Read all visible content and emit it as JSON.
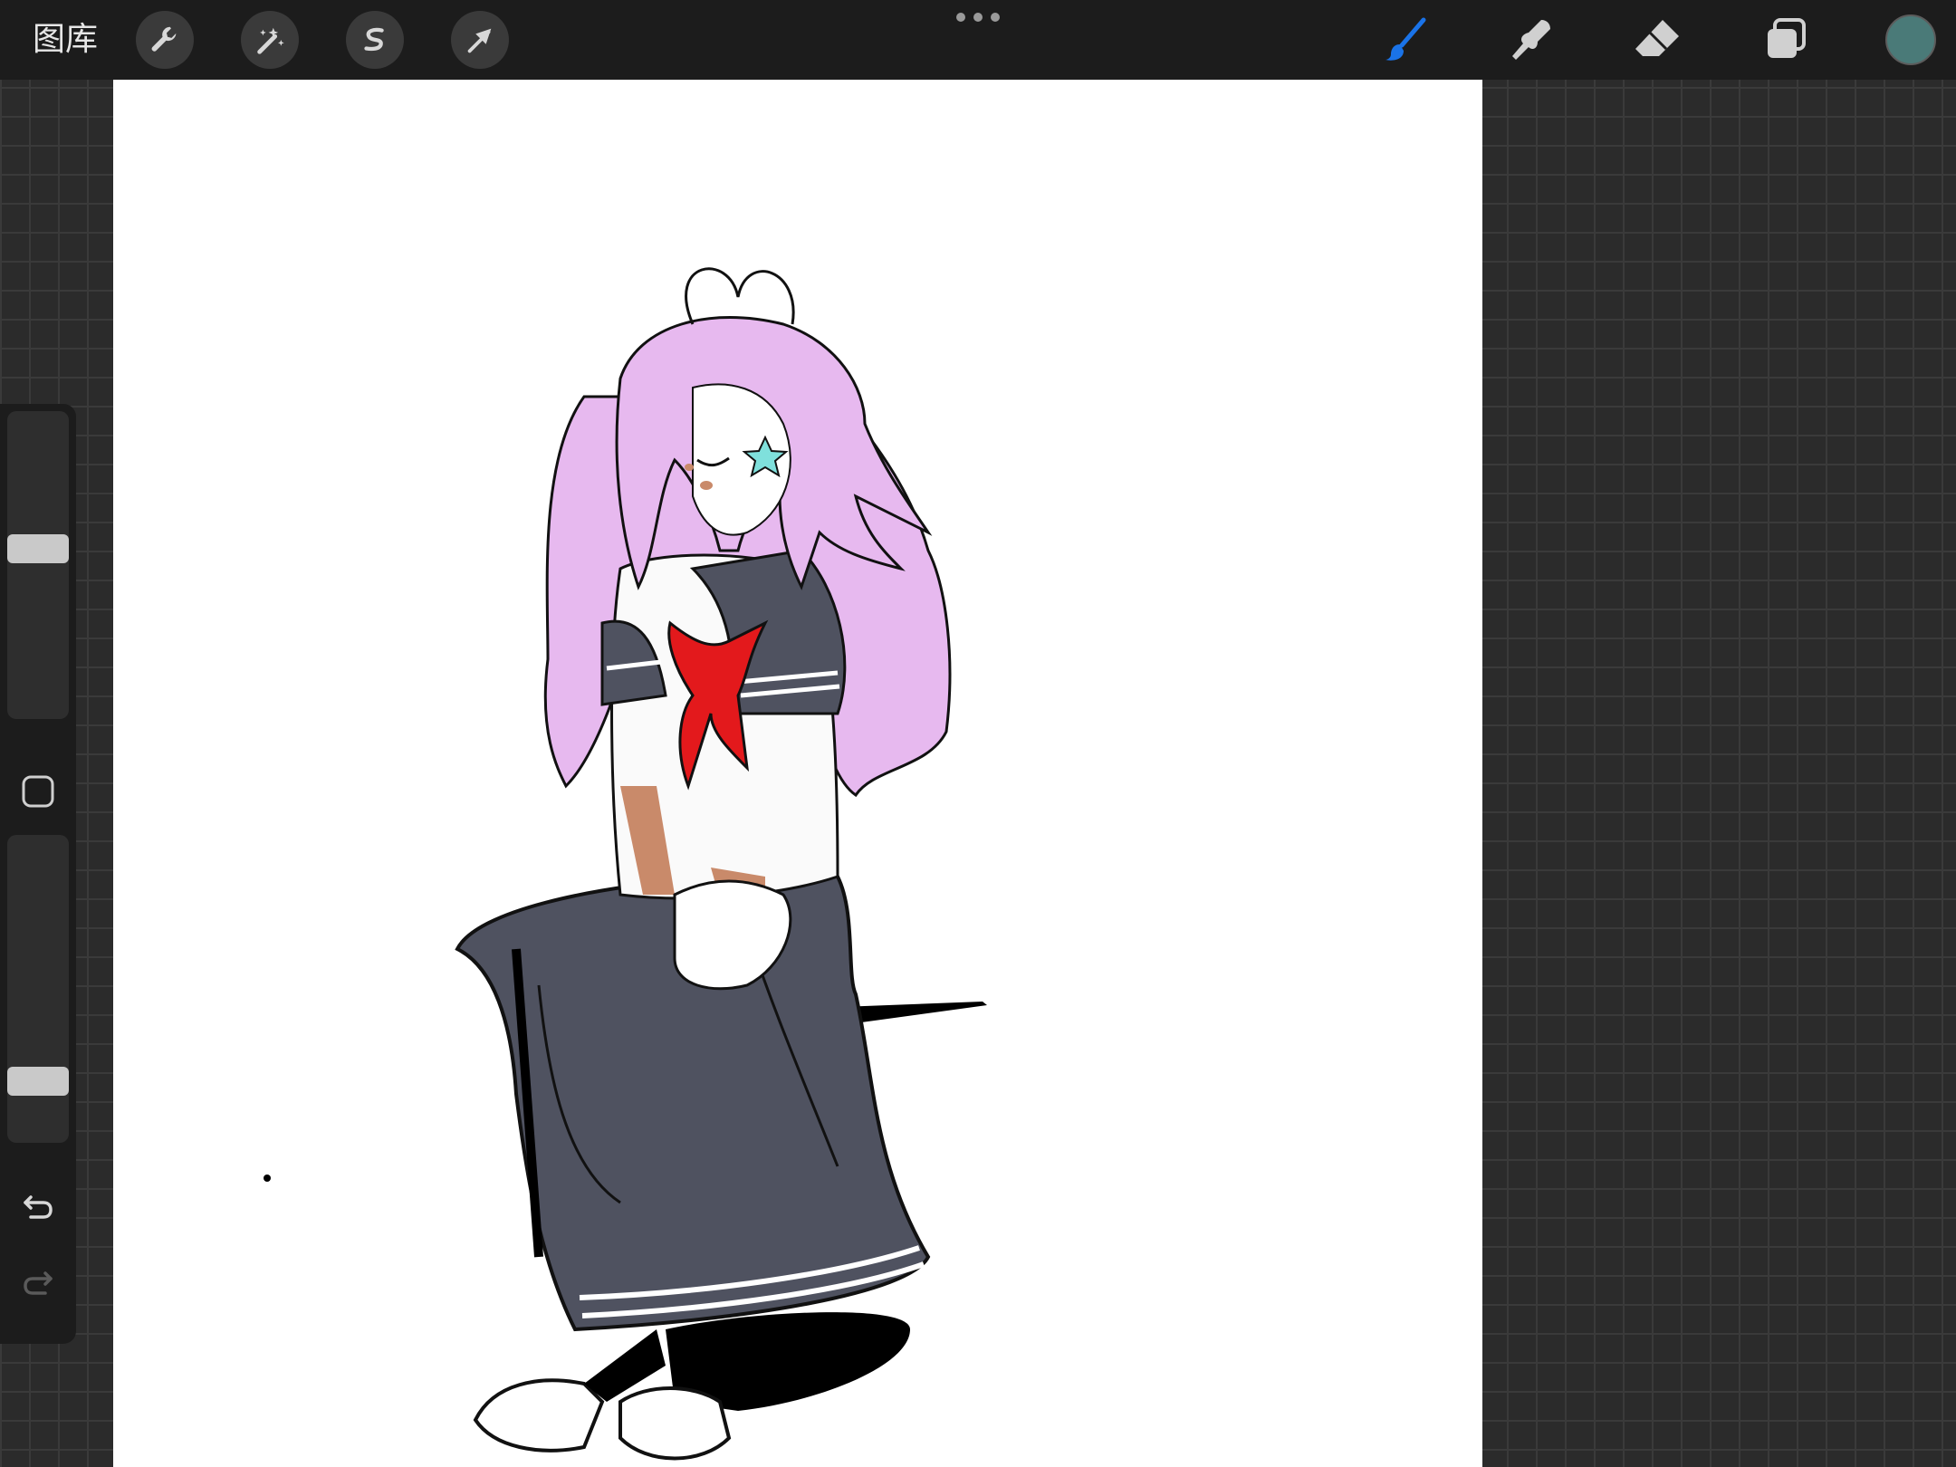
{
  "topbar": {
    "gallery_label": "图库",
    "left_tools": [
      "wrench-icon",
      "magic-wand-icon",
      "selection-s-icon",
      "transform-arrow-icon"
    ],
    "right_tools": [
      "brush-icon",
      "smudge-icon",
      "eraser-icon",
      "layers-icon"
    ],
    "active_tool": "brush",
    "active_color": "#1a73e8",
    "current_color": "#4a7a78"
  },
  "sidebar": {
    "brush_size_level": 0.56,
    "opacity_level": 0.17,
    "modify_icon": "square-icon",
    "undo_icon": "undo-icon",
    "redo_icon": "redo-icon"
  },
  "artwork": {
    "hair_color": "#e7b9ef",
    "uniform_color": "#4f5260",
    "ribbon_color": "#e3191c",
    "skin_color": "#c98a6a",
    "clip_color": "#7fe0dc"
  }
}
